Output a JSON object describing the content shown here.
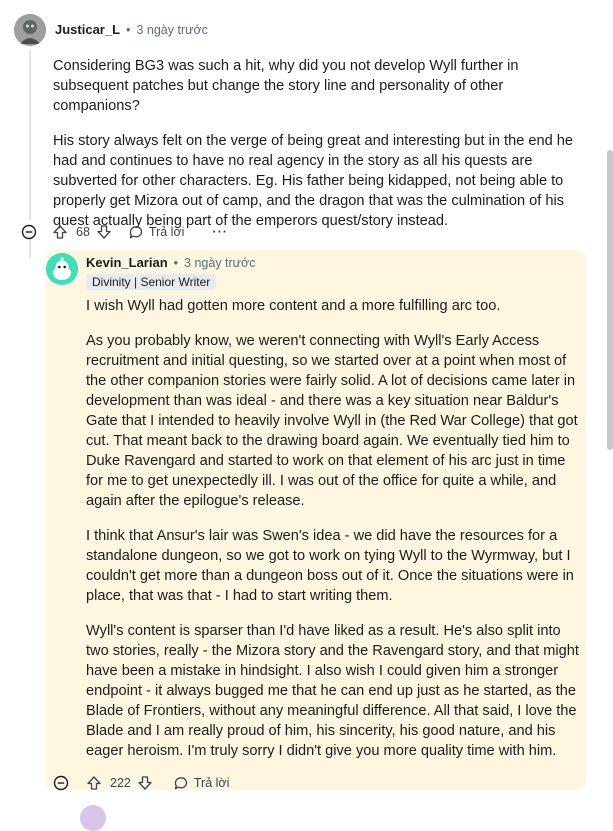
{
  "comment1": {
    "username": "Justicar_L",
    "separator": "•",
    "time": "3 ngày trước",
    "paragraphs": [
      "Considering BG3 was such a hit, why did you not develop Wyll further in subsequent patches but change the story line and personality of other companions?",
      "His story always felt on the verge of being great and interesting but in the end he had and continues to have no real agency in the story as all his quests are subverted for other characters. Eg. His father being kidapped, not being able to properly get Mizora out of camp, and the dragon that was the culmination of his quest actually being part of the emperors quest/story instead."
    ],
    "votes": "68",
    "reply_label": "Trả lời",
    "more_label": "···"
  },
  "comment2": {
    "username": "Kevin_Larian",
    "separator": "•",
    "time": "3 ngày trước",
    "flair": "Divinity | Senior Writer",
    "paragraphs": [
      "I wish Wyll had gotten more content and a more fulfilling arc too.",
      "As you probably know, we weren't connecting with Wyll's Early Access recruitment and initial questing, so we started over at a point when most of the other companion stories were fairly solid. A lot of decisions came later in development than was ideal - and there was a key situation near Baldur's Gate that I intended to heavily involve Wyll in (the Red War College) that got cut. That meant back to the drawing board again. We eventually tied him to Duke Ravengard and started to work on that element of his arc just in time for me to get unexpectedly ill. I was out of the office for quite a while, and again after the epilogue's release.",
      "I think that Ansur's lair was Swen's idea - we did have the resources for a standalone dungeon, so we got to work on tying Wyll to the Wyrmway, but I couldn't get more than a dungeon boss out of it. Once the situations were in place, that was that - I had to start writing them.",
      "Wyll's content is sparser than I'd have liked as a result. He's also split into two stories, really - the Mizora story and the Ravengard story, and that might have been a mistake in hindsight. I also wish I could given him a stronger endpoint - it always bugged me that he can end up just as he started, as the Blade of Frontiers, without any meaningful difference. All that said, I love the Blade and I am really proud of him, his sincerity, his good nature, and his eager heroism. I'm truly sorry I didn't give you more quality time with him."
    ],
    "votes": "222",
    "reply_label": "Trả lời"
  },
  "icons": {
    "collapse": "collapse-icon",
    "upvote": "upvote-icon",
    "downvote": "downvote-icon",
    "reply": "reply-icon",
    "more": "more-options-icon"
  },
  "colors": {
    "highlight_bg": "#fdf6e0",
    "muted_text": "#576f76",
    "avatar2_bg": "#3fe0b8"
  }
}
